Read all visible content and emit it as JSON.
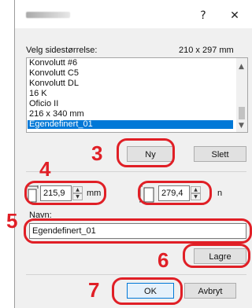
{
  "window": {
    "title_bar_icons": [
      "help-icon",
      "close-icon"
    ],
    "help_glyph": "?",
    "close_glyph": "✕"
  },
  "size_section": {
    "label": "Velg sidestørrelse:",
    "current_size": "210 x 297 mm",
    "items": [
      "Konvolutt #6",
      "Konvolutt C5",
      "Konvolutt DL",
      "16 K",
      "Oficio II",
      "216 x 340 mm",
      "Egendefinert_01"
    ],
    "selected_index": 6
  },
  "buttons": {
    "new": "Ny",
    "delete": "Slett",
    "save": "Lagre",
    "ok": "OK",
    "cancel": "Avbryt"
  },
  "dimensions": {
    "width_value": "215,9",
    "width_unit": "mm",
    "height_value": "279,4",
    "height_unit": "n"
  },
  "name_section": {
    "label": "Navn:",
    "value": "Egendefinert_01"
  },
  "callouts": {
    "step3": "3",
    "step4": "4",
    "step5": "5",
    "step6": "6",
    "step7": "7"
  },
  "colors": {
    "highlight": "#e01f26",
    "selection": "#0078d7"
  }
}
